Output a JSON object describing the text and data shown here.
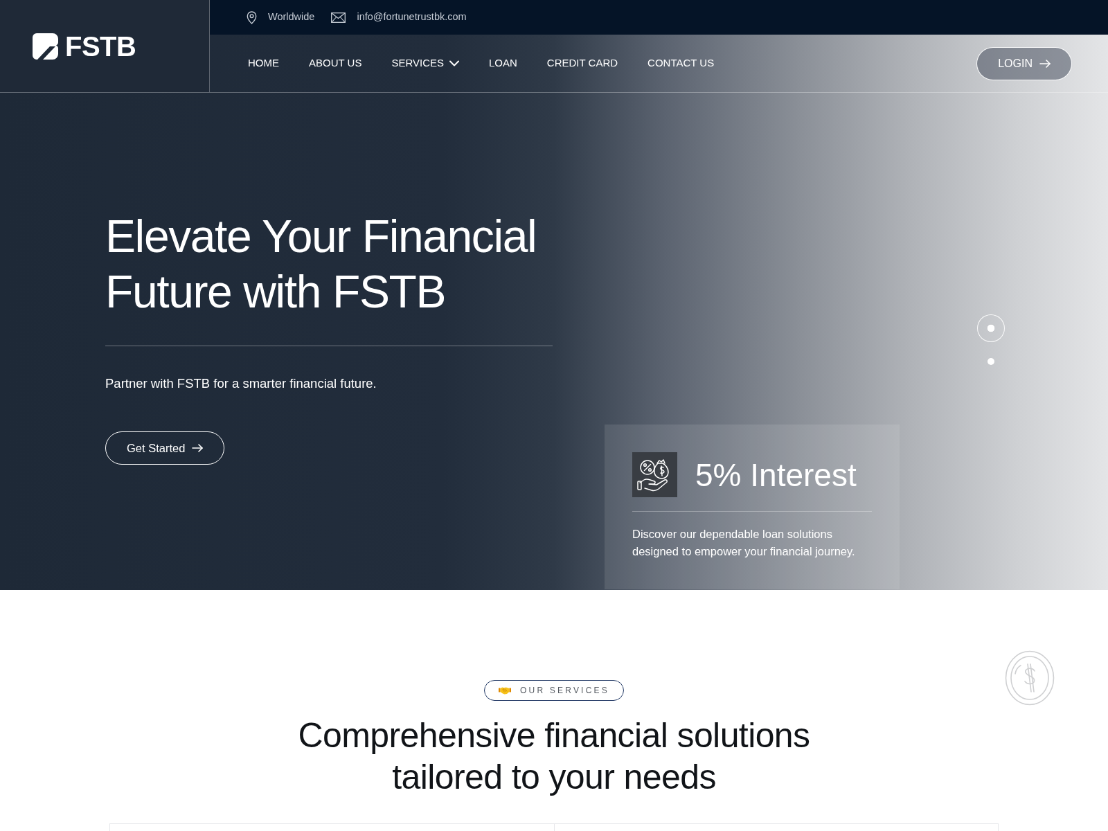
{
  "brand": {
    "logo_text": "FSTB"
  },
  "top_bar": {
    "location": "Worldwide",
    "email": "info@fortunetrustbk.com"
  },
  "nav": {
    "items": [
      {
        "label": "HOME",
        "dropdown": false
      },
      {
        "label": "ABOUT US",
        "dropdown": false
      },
      {
        "label": "SERVICES",
        "dropdown": true
      },
      {
        "label": "LOAN",
        "dropdown": false
      },
      {
        "label": "CREDIT CARD",
        "dropdown": false
      },
      {
        "label": "CONTACT US",
        "dropdown": false
      }
    ],
    "login_button": "LOGIN"
  },
  "hero": {
    "title_lines": [
      "Elevate Your Financial",
      "Future with FSTB"
    ],
    "subtitle": "Partner with FSTB for a smarter financial future.",
    "cta": "Get Started",
    "slider_dots": [
      {
        "selected": true
      },
      {
        "selected": false
      }
    ],
    "feature_card": {
      "title": "5% Interest",
      "description": "Discover our dependable loan solutions designed to empower your financial journey."
    }
  },
  "services": {
    "badge": "OUR SERVICES",
    "heading_lines": [
      "Comprehensive financial solutions",
      "tailored to your needs"
    ]
  }
}
